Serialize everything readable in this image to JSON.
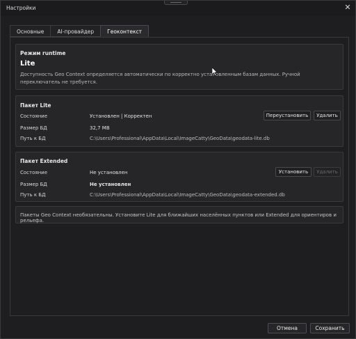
{
  "window": {
    "title": "Настройки",
    "close_glyph": "✕"
  },
  "tabs": [
    {
      "label": "Основные",
      "active": false
    },
    {
      "label": "AI-провайдер",
      "active": false
    },
    {
      "label": "Геоконтекст",
      "active": true
    }
  ],
  "runtime": {
    "title": "Режим runtime",
    "mode": "Lite",
    "description": "Доступность Geo Context определяется автоматически по корректно установленным базам данных. Ручной переключатель не требуется."
  },
  "lite": {
    "title": "Пакет Lite",
    "state_label": "Состояние",
    "state_value": "Установлен | Корректен",
    "size_label": "Размер БД",
    "size_value": "32,7 MB",
    "path_label": "Путь к БД",
    "path_value": "C:\\Users\\Professional\\AppData\\Local\\ImageCatty\\GeoData\\geodata-lite.db",
    "reinstall_label": "Переустановить",
    "delete_label": "Удалить"
  },
  "extended": {
    "title": "Пакет Extended",
    "state_label": "Состояние",
    "state_value": "Не установлен",
    "size_label": "Размер БД",
    "size_value": "Не установлен",
    "path_label": "Путь к БД",
    "path_value": "C:\\Users\\Professional\\AppData\\Local\\ImageCatty\\GeoData\\geodata-extended.db",
    "install_label": "Установить",
    "delete_label": "Удалить"
  },
  "note": "Пакеты Geo Context необязательны. Установите Lite для ближайших населённых пунктов или Extended для ориентиров и рельефа.",
  "footer": {
    "cancel_label": "Отмена",
    "save_label": "Сохранить"
  },
  "icons": [
    "close-icon",
    "mouse-cursor-icon",
    "drag-grip-icon"
  ]
}
